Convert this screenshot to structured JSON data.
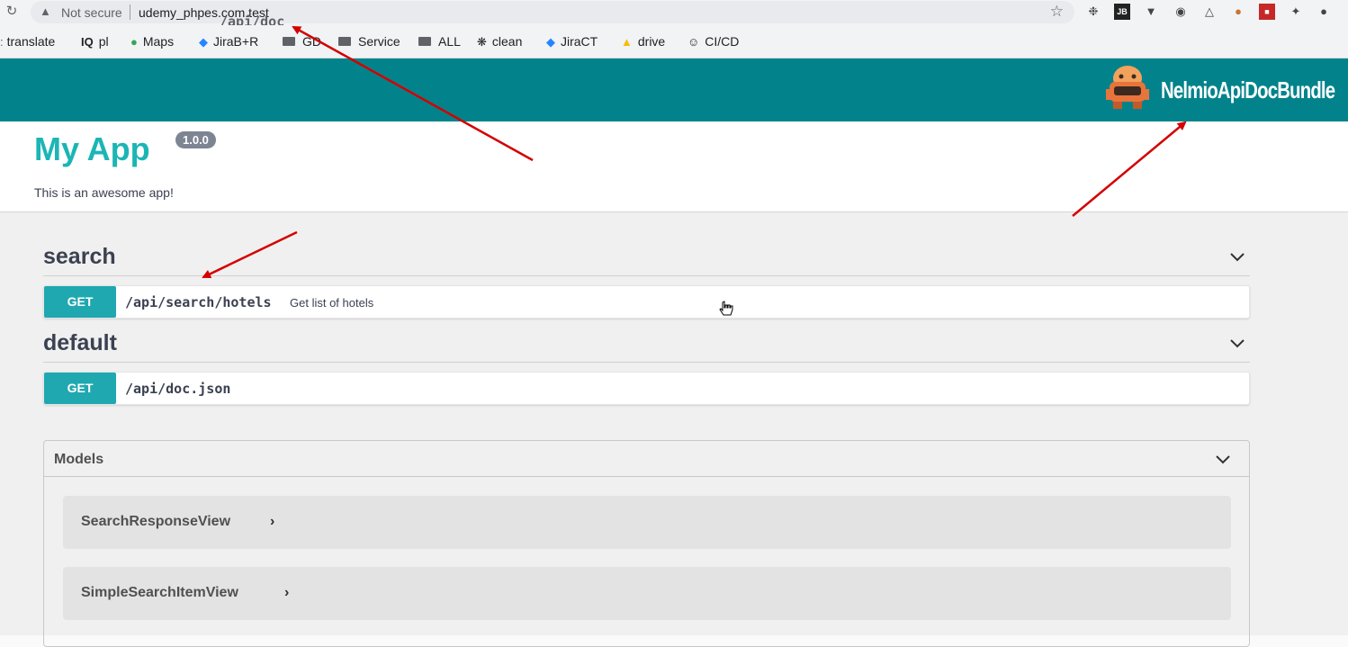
{
  "browser": {
    "security_label": "Not secure",
    "url_host": "udemy_phpes.com.test",
    "url_path": "/api/doc"
  },
  "bookmarks": [
    {
      "label": "translate",
      "icon": "translate-icon"
    },
    {
      "label": "pl",
      "icon": "iq-icon"
    },
    {
      "label": "Maps",
      "icon": "maps-pin-icon"
    },
    {
      "label": "JiraB+R",
      "icon": "jira-icon"
    },
    {
      "label": "GD",
      "icon": "folder-icon"
    },
    {
      "label": "Service",
      "icon": "folder-icon"
    },
    {
      "label": "ALL",
      "icon": "folder-icon"
    },
    {
      "label": "clean",
      "icon": "gear-icon"
    },
    {
      "label": "JiraCT",
      "icon": "jira-icon"
    },
    {
      "label": "drive",
      "icon": "drive-icon"
    },
    {
      "label": "CI/CD",
      "icon": "avatar-icon"
    }
  ],
  "topbar": {
    "logo_text": "NelmioApiDocBundle",
    "bg_color": "#02838b"
  },
  "info": {
    "title": "My App",
    "version": "1.0.0",
    "description": "This is an awesome app!"
  },
  "tags": [
    {
      "name": "search",
      "operations": [
        {
          "method": "GET",
          "path": "/api/search/hotels",
          "summary": "Get list of hotels"
        }
      ]
    },
    {
      "name": "default",
      "operations": [
        {
          "method": "GET",
          "path": "/api/doc.json",
          "summary": ""
        }
      ]
    }
  ],
  "models": {
    "title": "Models",
    "items": [
      {
        "name": "SearchResponseView"
      },
      {
        "name": "SimpleSearchItemView"
      }
    ]
  },
  "colors": {
    "accent": "#1cb5b5",
    "get_method": "#1fa8b0",
    "annotation_arrow": "#d40000"
  }
}
